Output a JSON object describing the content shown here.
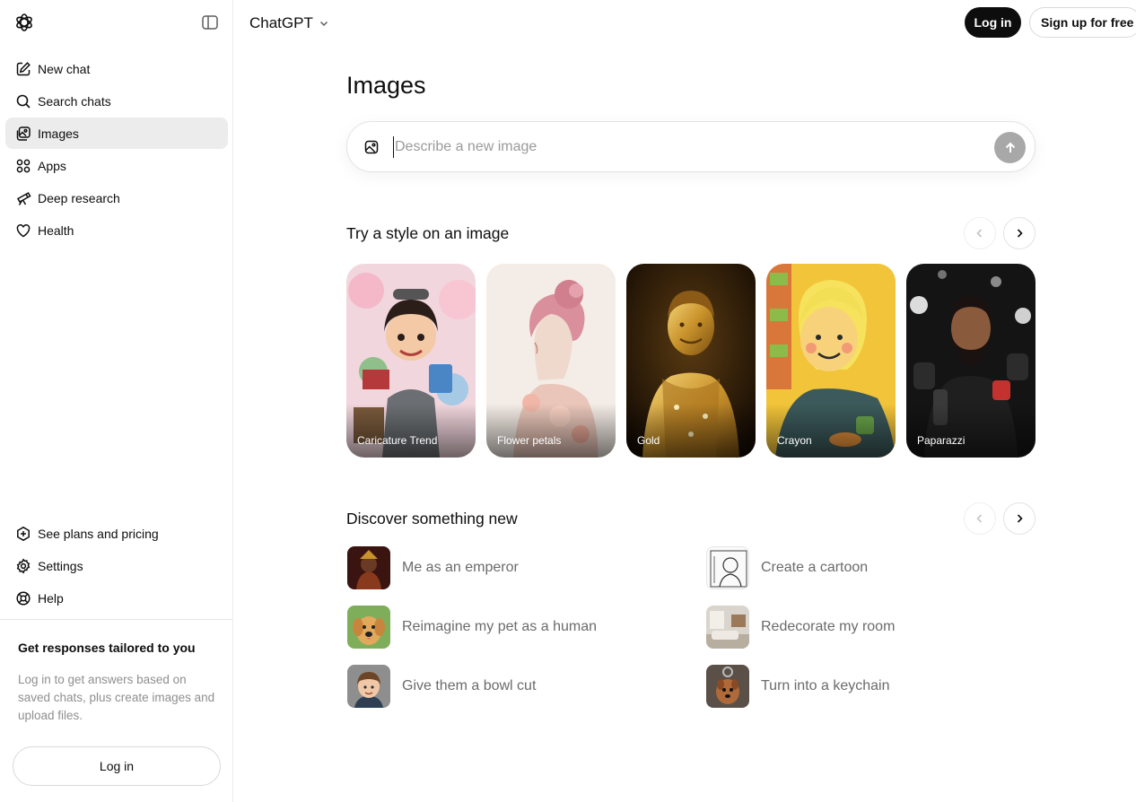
{
  "header": {
    "model": "ChatGPT",
    "login_label": "Log in",
    "signup_label": "Sign up for free"
  },
  "sidebar": {
    "items": [
      {
        "label": "New chat",
        "icon": "compose-icon"
      },
      {
        "label": "Search chats",
        "icon": "search-icon"
      },
      {
        "label": "Images",
        "icon": "images-icon"
      },
      {
        "label": "Apps",
        "icon": "apps-grid-icon"
      },
      {
        "label": "Deep research",
        "icon": "telescope-icon"
      },
      {
        "label": "Health",
        "icon": "heart-icon"
      }
    ],
    "bottom_items": [
      {
        "label": "See plans and pricing",
        "icon": "plans-icon"
      },
      {
        "label": "Settings",
        "icon": "gear-icon"
      },
      {
        "label": "Help",
        "icon": "help-lifebuoy-icon"
      }
    ],
    "promo_title": "Get responses tailored to you",
    "promo_text": "Log in to get answers based on saved chats, plus create images and upload files.",
    "login_label": "Log in"
  },
  "main": {
    "title": "Images",
    "composer_placeholder": "Describe a new image",
    "styles_title": "Try a style on an image",
    "styles": [
      {
        "label": "Caricature Trend"
      },
      {
        "label": "Flower petals"
      },
      {
        "label": "Gold"
      },
      {
        "label": "Crayon"
      },
      {
        "label": "Paparazzi"
      }
    ],
    "discover_title": "Discover something new",
    "discover": [
      {
        "label": "Me as an emperor"
      },
      {
        "label": "Create a cartoon"
      },
      {
        "label": "Reimagine my pet as a human"
      },
      {
        "label": "Redecorate my room"
      },
      {
        "label": "Give them a bowl cut"
      },
      {
        "label": "Turn into a keychain"
      }
    ]
  },
  "colors": {
    "accent_dark": "#0d0d0d",
    "active_nav": "#ececec",
    "send_button": "#a8a8a8"
  }
}
